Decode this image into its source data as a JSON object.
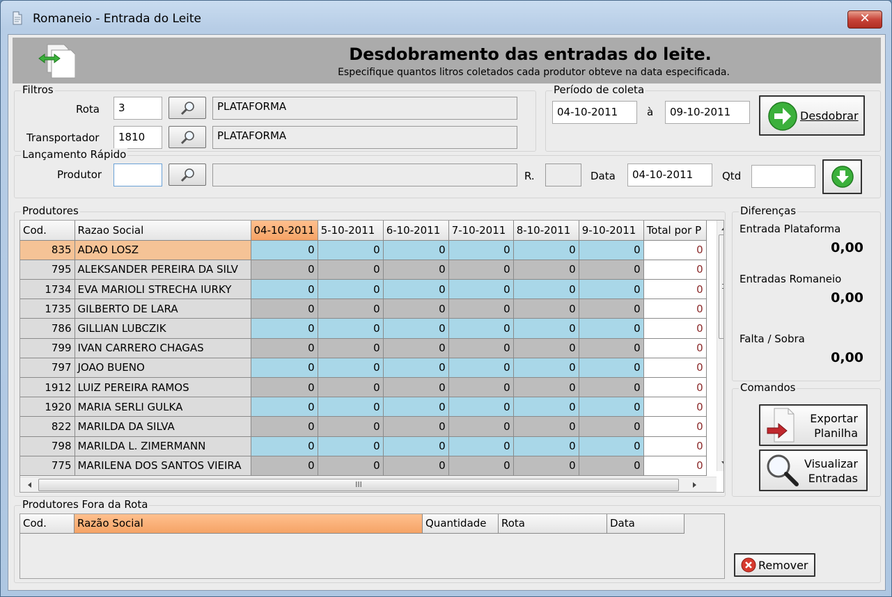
{
  "window": {
    "title": "Romaneio - Entrada do Leite",
    "close": "✕"
  },
  "header": {
    "title": "Desdobramento das entradas do leite.",
    "subtitle": "Especifique quantos litros coletados cada produtor obteve na data especificada."
  },
  "filtros": {
    "label": "Filtros",
    "rota_label": "Rota",
    "rota_value": "3",
    "rota_desc": "PLATAFORMA",
    "transp_label": "Transportador",
    "transp_value": "1810",
    "transp_desc": "PLATAFORMA"
  },
  "periodo": {
    "label": "Período de coleta",
    "start": "04-10-2011",
    "sep": "à",
    "end": "09-10-2011",
    "button": "Desdobrar"
  },
  "lancamento": {
    "label": "Lançamento Rápido",
    "produtor_label": "Produtor",
    "produtor_value": "",
    "produtor_desc": "",
    "r_label": "R.",
    "r_value": "",
    "data_label": "Data",
    "data_value": "04-10-2011",
    "qtd_label": "Qtd",
    "qtd_value": ""
  },
  "produtores": {
    "label": "Produtores",
    "columns": [
      "Cod.",
      "Razao Social",
      "04-10-2011",
      "5-10-2011",
      "6-10-2011",
      "7-10-2011",
      "8-10-2011",
      "9-10-2011",
      "Total por P"
    ],
    "rows": [
      {
        "cod": "835",
        "nome": "ADAO LOSZ",
        "v": [
          "0",
          "0",
          "0",
          "0",
          "0",
          "0"
        ],
        "tot": "0"
      },
      {
        "cod": "795",
        "nome": "ALEKSANDER PEREIRA DA SILV",
        "v": [
          "0",
          "0",
          "0",
          "0",
          "0",
          "0"
        ],
        "tot": "0"
      },
      {
        "cod": "1734",
        "nome": "EVA MARIOLI STRECHA IURKY",
        "v": [
          "0",
          "0",
          "0",
          "0",
          "0",
          "0"
        ],
        "tot": "0"
      },
      {
        "cod": "1735",
        "nome": "GILBERTO DE LARA",
        "v": [
          "0",
          "0",
          "0",
          "0",
          "0",
          "0"
        ],
        "tot": "0"
      },
      {
        "cod": "786",
        "nome": "GILLIAN LUBCZIK",
        "v": [
          "0",
          "0",
          "0",
          "0",
          "0",
          "0"
        ],
        "tot": "0"
      },
      {
        "cod": "799",
        "nome": "IVAN CARRERO CHAGAS",
        "v": [
          "0",
          "0",
          "0",
          "0",
          "0",
          "0"
        ],
        "tot": "0"
      },
      {
        "cod": "797",
        "nome": "JOAO BUENO",
        "v": [
          "0",
          "0",
          "0",
          "0",
          "0",
          "0"
        ],
        "tot": "0"
      },
      {
        "cod": "1912",
        "nome": "LUIZ PEREIRA RAMOS",
        "v": [
          "0",
          "0",
          "0",
          "0",
          "0",
          "0"
        ],
        "tot": "0"
      },
      {
        "cod": "1920",
        "nome": "MARIA SERLI GULKA",
        "v": [
          "0",
          "0",
          "0",
          "0",
          "0",
          "0"
        ],
        "tot": "0"
      },
      {
        "cod": "822",
        "nome": "MARILDA DA SILVA",
        "v": [
          "0",
          "0",
          "0",
          "0",
          "0",
          "0"
        ],
        "tot": "0"
      },
      {
        "cod": "798",
        "nome": "MARILDA L. ZIMERMANN",
        "v": [
          "0",
          "0",
          "0",
          "0",
          "0",
          "0"
        ],
        "tot": "0"
      },
      {
        "cod": "775",
        "nome": "MARILENA DOS SANTOS VIEIRA",
        "v": [
          "0",
          "0",
          "0",
          "0",
          "0",
          "0"
        ],
        "tot": "0"
      }
    ],
    "hscroll_grip": "III"
  },
  "diferencas": {
    "label": "Diferenças",
    "entrada_plataforma_label": "Entrada Plataforma",
    "entrada_plataforma_value": "0,00",
    "entradas_romaneio_label": "Entradas Romaneio",
    "entradas_romaneio_value": "0,00",
    "falta_sobra_label": "Falta / Sobra",
    "falta_sobra_value": "0,00"
  },
  "comandos": {
    "label": "Comandos",
    "exportar_line1": "Exportar",
    "exportar_line2": "Planilha",
    "visualizar_line1": "Visualizar",
    "visualizar_line2": "Entradas"
  },
  "fora_rota": {
    "label": "Produtores Fora da Rota",
    "columns": [
      "Cod.",
      "Razão Social",
      "Quantidade",
      "Rota",
      "Data"
    ],
    "remover": "Remover"
  },
  "colors": {
    "row_blue": "#a9d7e8",
    "row_gray": "#bdbdbd",
    "header_active": "#f5a366"
  }
}
